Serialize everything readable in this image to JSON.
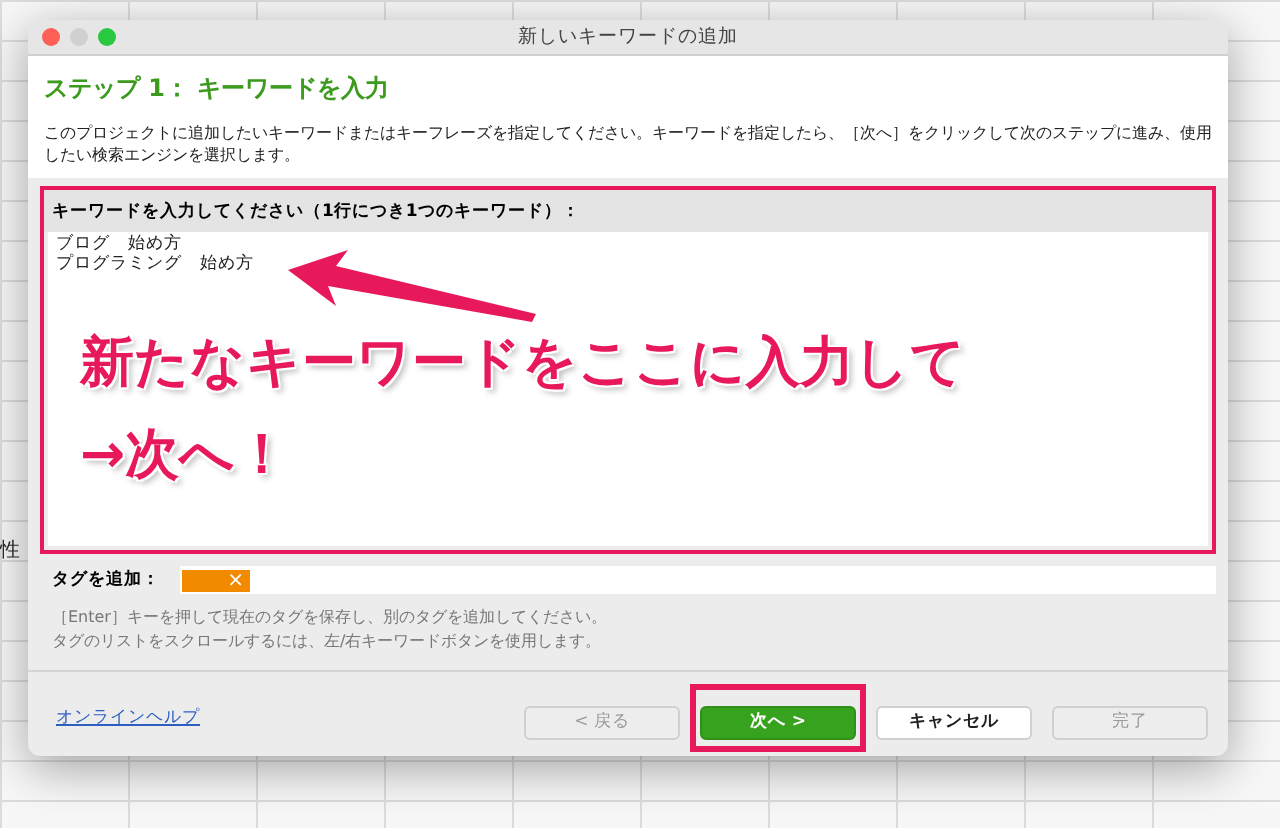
{
  "background": {
    "cell_text": "性"
  },
  "window": {
    "title": "新しいキーワードの追加"
  },
  "step_title": "ステップ 1： キーワードを入力",
  "description": "このプロジェクトに追加したいキーワードまたはキーフレーズを指定してください。キーワードを指定したら、［次へ］をクリックして次のステップに進み、使用したい検索エンジンを選択します。",
  "keyword_panel": {
    "label": "キーワードを入力してください（1行につき1つのキーワード）：",
    "highlighted": true,
    "lines": [
      "ブログ　始め方",
      "プログラミング　始め方"
    ]
  },
  "annotation": {
    "lines": [
      "新たなキーワードをここに入力して",
      "→次へ！"
    ]
  },
  "tag_field": {
    "label": "タグを追加：",
    "tags": [
      {
        "color": "#f28a00",
        "remove": "×"
      }
    ]
  },
  "hints": [
    "［Enter］キーを押して現在のタグを保存し、別のタグを追加してください。",
    "タグのリストをスクロールするには、左/右キーワードボタンを使用します。"
  ],
  "help_link": "オンラインヘルプ",
  "buttons": [
    {
      "label": "< 戻る",
      "kind": "default",
      "disabled": true,
      "highlighted": false
    },
    {
      "label": "次へ >",
      "kind": "primary",
      "disabled": false,
      "highlighted": true
    },
    {
      "label": "キャンセル",
      "kind": "default",
      "disabled": false,
      "highlighted": false
    },
    {
      "label": "完了",
      "kind": "default",
      "disabled": true,
      "highlighted": false
    }
  ]
}
